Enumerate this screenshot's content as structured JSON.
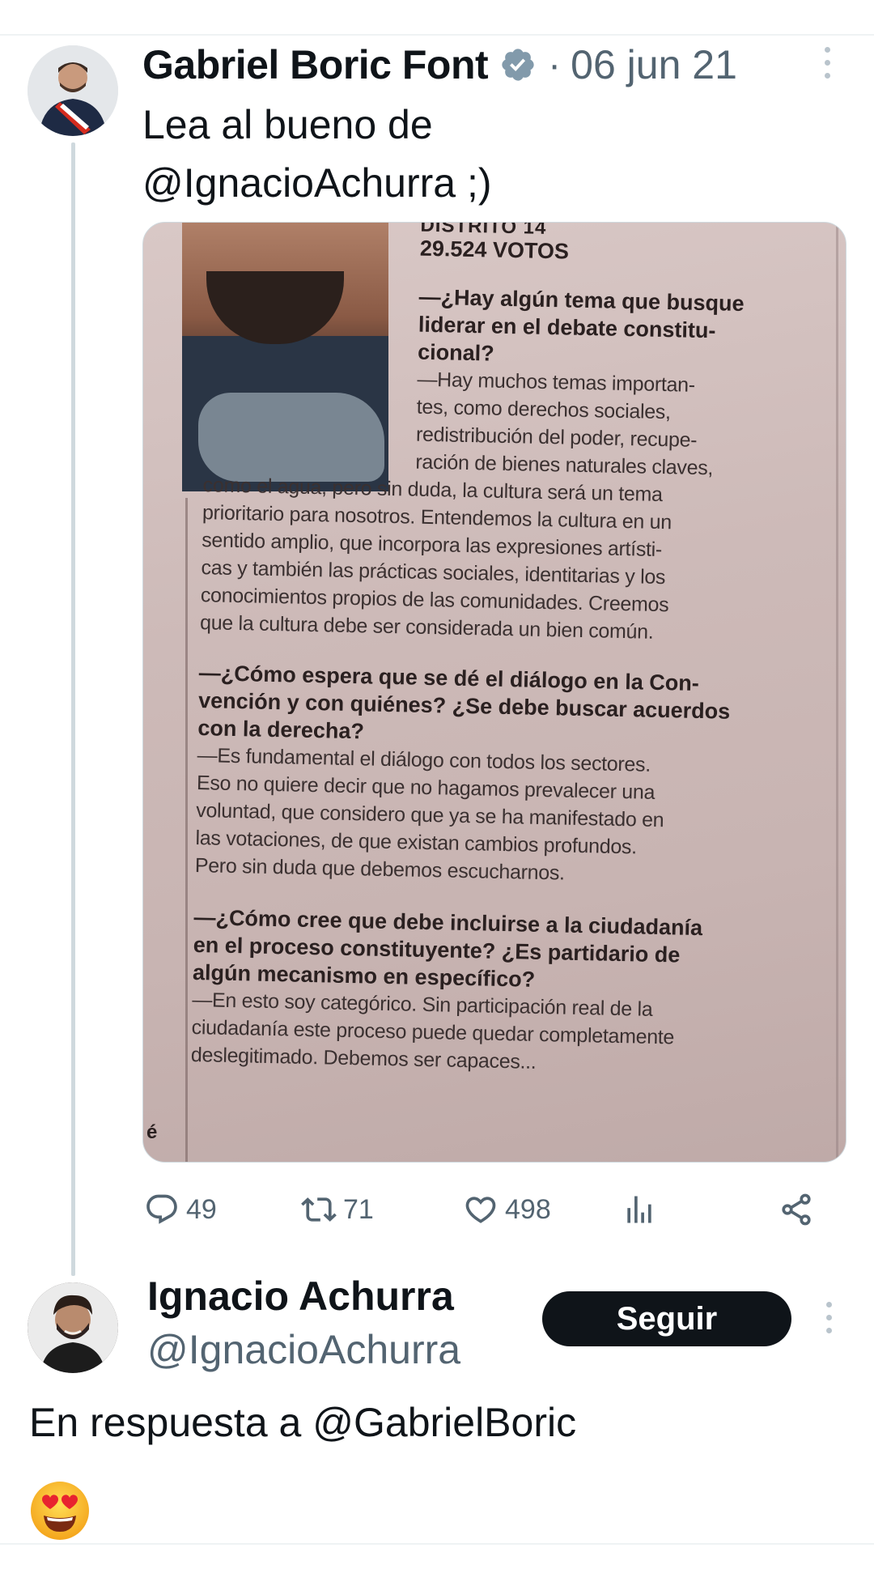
{
  "tweet": {
    "author_name": "Gabriel Boric Font",
    "separator": "·",
    "date": "06 jun 21",
    "text_line1": "Lea al bueno de",
    "text_line2": "@IgnacioAchurra ;)",
    "icons": {
      "verified": "verified-badge-icon",
      "more": "more-vertical-icon"
    }
  },
  "clipping": {
    "district": "DISTRITO 14",
    "votes": "29.524 VOTOS",
    "q1": [
      "—¿Hay algún tema que busque",
      "liderar en el debate constitu-",
      "cional?"
    ],
    "a1": [
      "—Hay muchos temas importan-",
      "tes, como derechos sociales,",
      "redistribución del poder, recupe-",
      "ración de bienes naturales claves,",
      "como el agua, pero sin duda, la cultura será un tema",
      "prioritario para nosotros. Entendemos la cultura en un",
      "sentido amplio, que incorpora las expresiones artísti-",
      "cas y también las prácticas sociales, identitarias y los",
      "conocimientos propios de las comunidades. Creemos",
      "que la cultura debe ser considerada un bien común."
    ],
    "q2": [
      "—¿Cómo espera que se dé el diálogo en la Con-",
      "vención y con quiénes? ¿Se debe buscar acuerdos",
      "con la derecha?"
    ],
    "a2": [
      "—Es fundamental el diálogo con todos los sectores.",
      "Eso no quiere decir que no hagamos prevalecer una",
      "voluntad, que considero que ya se ha manifestado en",
      "las votaciones, de que existan cambios profundos.",
      "Pero sin duda que debemos escucharnos."
    ],
    "q3": [
      "—¿Cómo cree que debe incluirse a la ciudadanía",
      "en el proceso constituyente? ¿Es partidario de",
      "algún mecanismo en específico?"
    ],
    "a3": [
      "—En esto soy categórico. Sin participación real de la",
      "ciudadanía este proceso puede quedar completamente",
      "deslegitimado. Debemos ser capaces..."
    ],
    "margin_fragment": "é"
  },
  "actions": {
    "replies": "49",
    "reposts": "71",
    "likes": "498",
    "icons": {
      "reply": "reply-icon",
      "repost": "repost-icon",
      "like": "heart-icon",
      "views": "views-chart-icon",
      "share": "share-icon"
    }
  },
  "reply": {
    "author_name": "Ignacio Achurra",
    "handle": "@IgnacioAchurra",
    "follow_label": "Seguir",
    "reply_prefix": "En respuesta a",
    "reply_mention": "@GabrielBoric",
    "emoji": "😍",
    "emoji_icon": "heart-eyes-emoji-icon"
  },
  "colors": {
    "text": "#0f1419",
    "secondary": "#536471",
    "verified": "#829aab",
    "follow_bg": "#0f1419",
    "divider": "#eff3f4"
  }
}
